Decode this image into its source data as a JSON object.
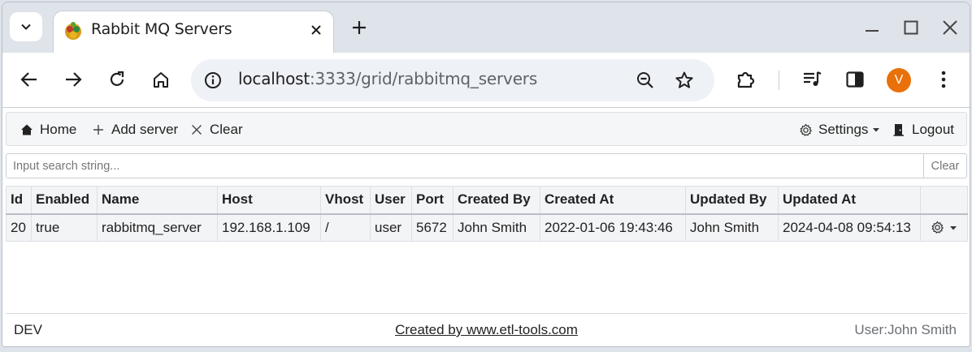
{
  "browser": {
    "tab_title": "Rabbit MQ Servers",
    "url_host": "localhost",
    "url_path": ":3333/grid/rabbitmq_servers",
    "profile_initial": "V",
    "profile_color": "#e8710a"
  },
  "menu": {
    "home_label": "Home",
    "add_server_label": "Add server",
    "clear_label": "Clear",
    "settings_label": "Settings",
    "logout_label": "Logout"
  },
  "search": {
    "placeholder": "Input search string...",
    "value": "",
    "clear_label": "Clear"
  },
  "grid": {
    "columns": [
      "Id",
      "Enabled",
      "Name",
      "Host",
      "Vhost",
      "User",
      "Port",
      "Created By",
      "Created At",
      "Updated By",
      "Updated At",
      ""
    ],
    "rows": [
      [
        "20",
        "true",
        "rabbitmq_server",
        "192.168.1.109",
        "/",
        "user",
        "5672",
        "John Smith",
        "2022-01-06 19:43:46",
        "John Smith",
        "2024-04-08 09:54:13"
      ]
    ]
  },
  "footer": {
    "env": "DEV",
    "credit": "Created by www.etl-tools.com",
    "user": "User:John Smith"
  },
  "icons": {
    "tab_list": "chevron-down-icon",
    "favicon": "rabbit-favicon-icon",
    "close": "close-icon",
    "new_tab": "plus-icon",
    "back": "arrow-left-icon",
    "forward": "arrow-right-icon",
    "reload": "reload-icon",
    "home": "home-icon",
    "site_info": "info-icon",
    "zoom": "zoom-out-icon",
    "bookmark": "star-icon",
    "extensions": "puzzle-icon",
    "media": "media-controls-icon",
    "side_panel": "side-panel-icon",
    "more": "kebab-menu-icon",
    "settings": "gear-icon",
    "logout": "door-icon"
  }
}
